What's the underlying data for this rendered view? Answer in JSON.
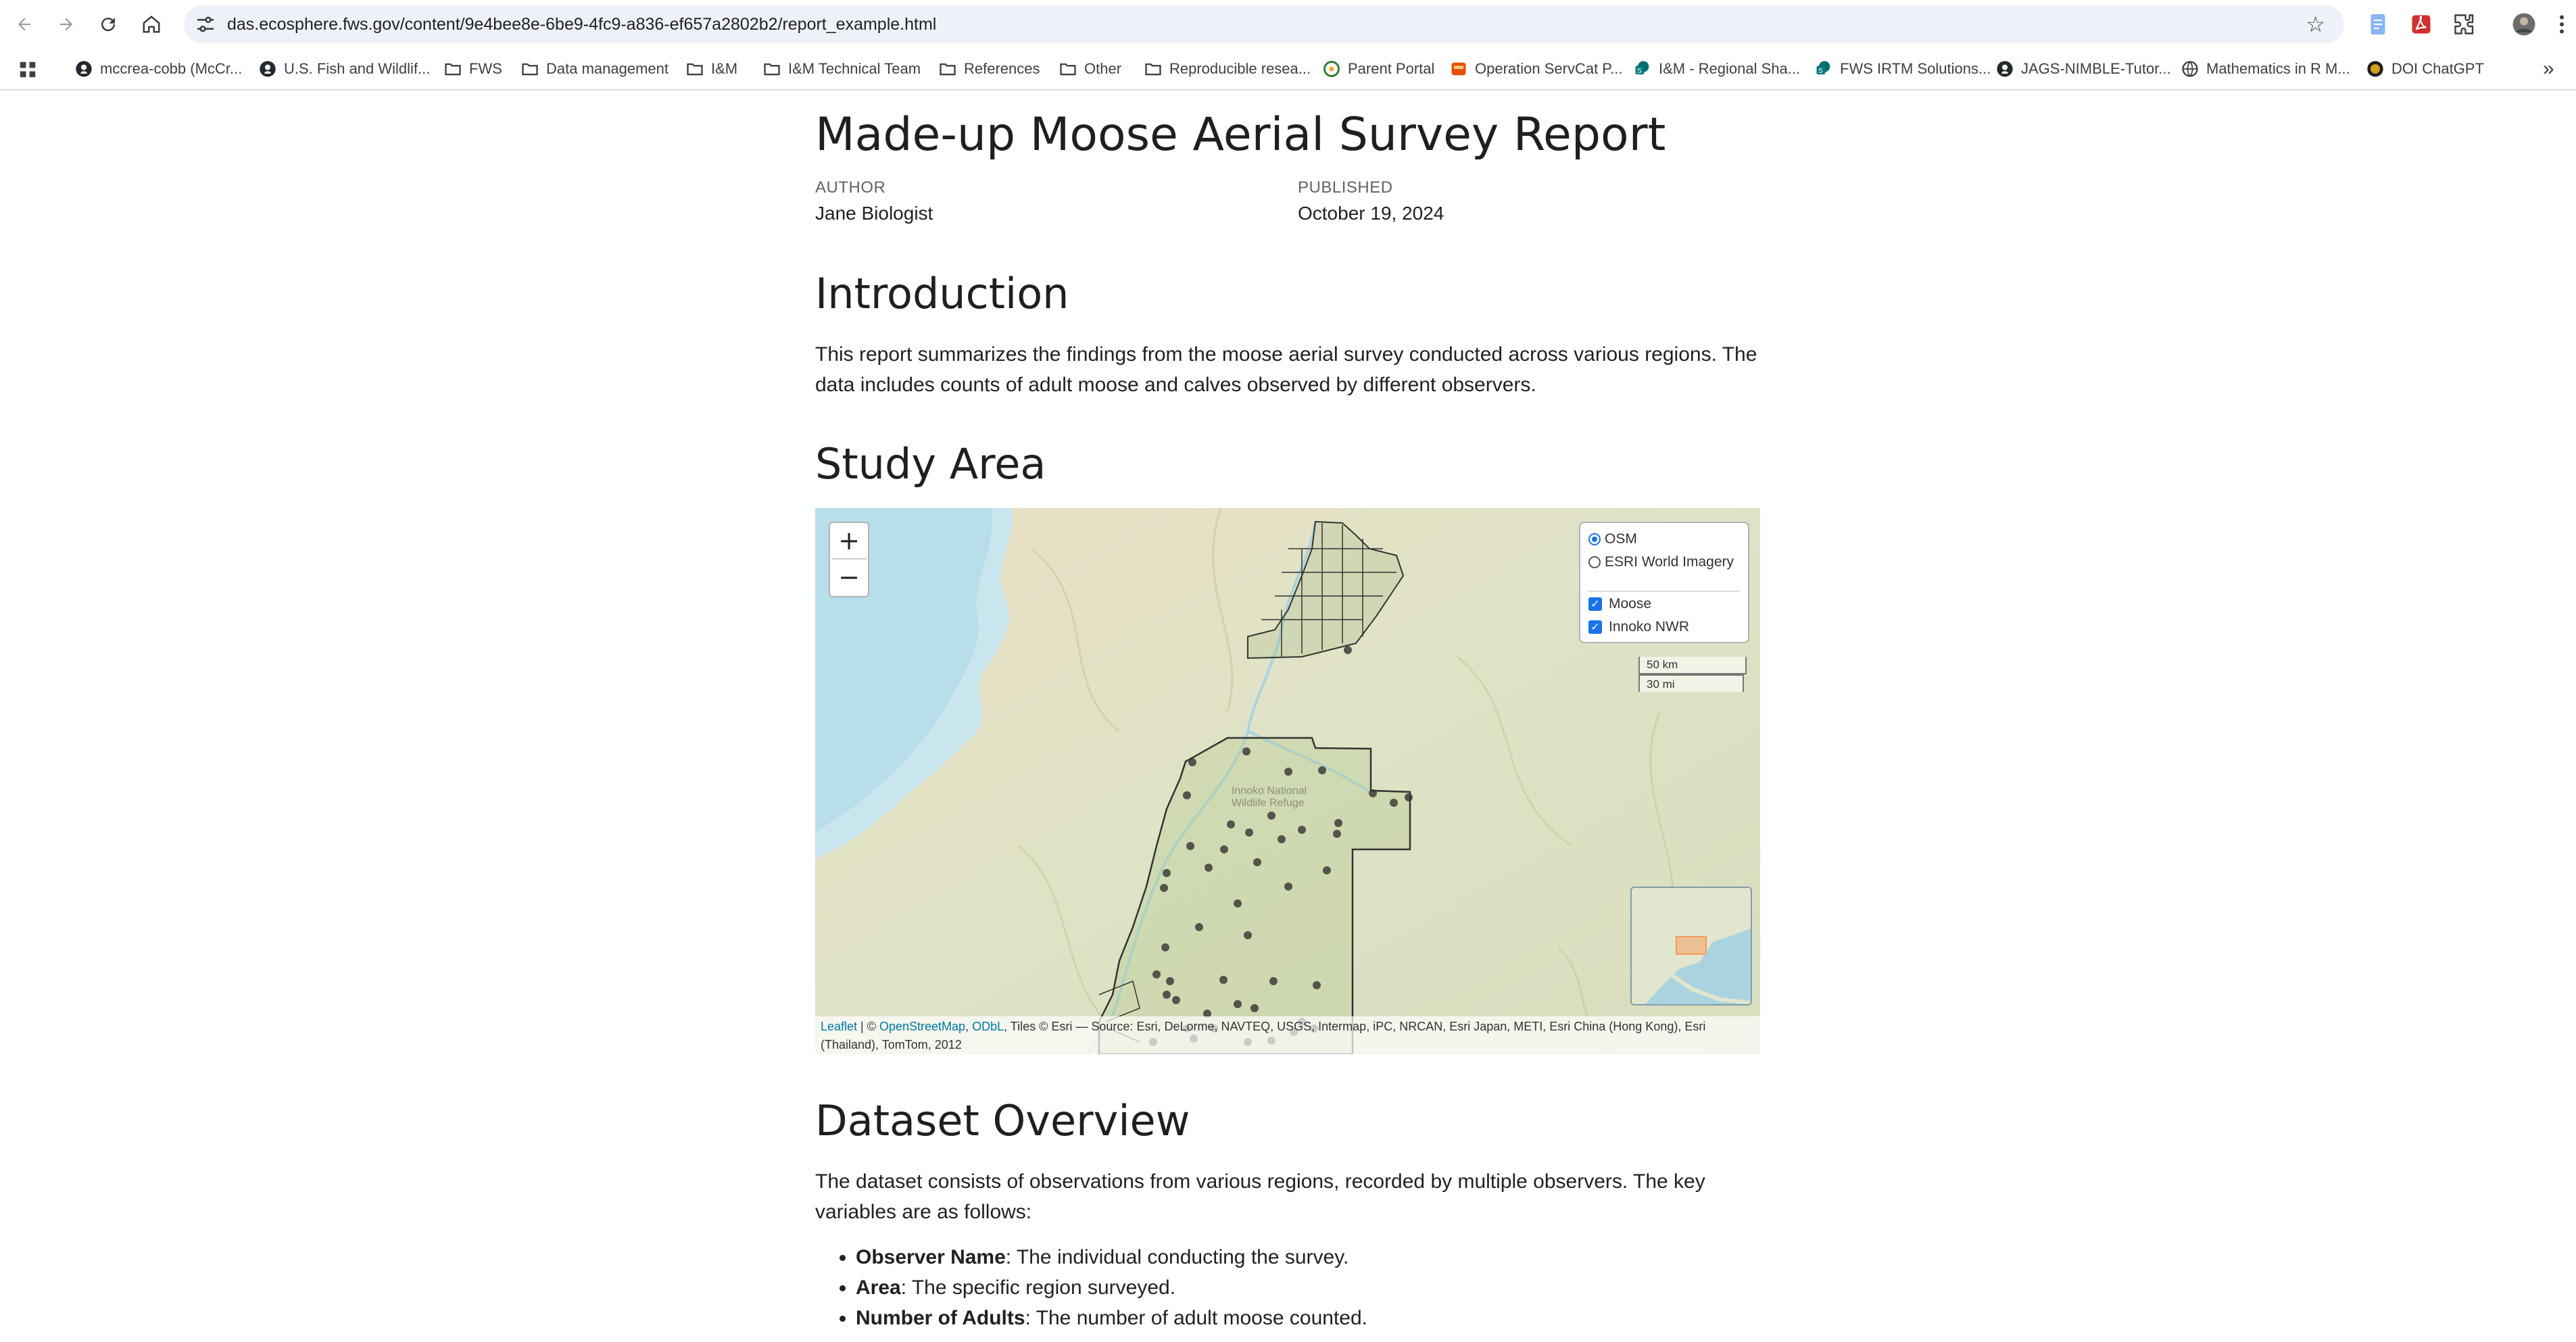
{
  "browser": {
    "url": "das.ecosphere.fws.gov/content/9e4bee8e-6be9-4fc9-a836-ef657a2802b2/report_example.html",
    "nav_icons": [
      "back-arrow-icon",
      "forward-arrow-icon",
      "reload-icon",
      "home-icon"
    ],
    "extension_icons": [
      "docs-icon",
      "acrobat-icon",
      "puzzle-icon",
      "profile-avatar",
      "kebab-menu-icon"
    ],
    "bookmarks": [
      {
        "label": "mccrea-cobb (McCr...",
        "icon": "github-icon"
      },
      {
        "label": "U.S. Fish and Wildlif...",
        "icon": "github-icon"
      },
      {
        "label": "FWS",
        "icon": "folder-icon"
      },
      {
        "label": "Data management",
        "icon": "folder-icon"
      },
      {
        "label": "I&M",
        "icon": "folder-icon"
      },
      {
        "label": "I&M Technical Team",
        "icon": "folder-icon"
      },
      {
        "label": "References",
        "icon": "folder-icon"
      },
      {
        "label": "Other",
        "icon": "folder-icon"
      },
      {
        "label": "Reproducible resea...",
        "icon": "folder-icon"
      },
      {
        "label": "Parent Portal",
        "icon": "portal-icon"
      },
      {
        "label": "Operation ServCat P...",
        "icon": "servcat-icon"
      },
      {
        "label": "I&M - Regional Sha...",
        "icon": "sharepoint-icon"
      },
      {
        "label": "FWS IRTM Solutions...",
        "icon": "sharepoint-icon"
      },
      {
        "label": "JAGS-NIMBLE-Tutor...",
        "icon": "github-icon"
      },
      {
        "label": "Mathematics in R M...",
        "icon": "globe-icon"
      },
      {
        "label": "DOI ChatGPT",
        "icon": "chatgpt-icon"
      }
    ],
    "more_bookmarks": "»"
  },
  "article": {
    "title": "Made-up Moose Aerial Survey Report",
    "author_label": "AUTHOR",
    "author": "Jane Biologist",
    "published_label": "PUBLISHED",
    "published": "October 19, 2024",
    "intro_heading": "Introduction",
    "intro_text": "This report summarizes the findings from the moose aerial survey conducted across various regions. The data includes counts of adult moose and calves observed by different observers.",
    "study_heading": "Study Area",
    "dataset_heading": "Dataset Overview",
    "dataset_text": "The dataset consists of observations from various regions, recorded by multiple observers. The key variables are as follows:",
    "variables": [
      {
        "name": "Observer Name",
        "desc": ": The individual conducting the survey."
      },
      {
        "name": "Area",
        "desc": ": The specific region surveyed."
      },
      {
        "name": "Number of Adults",
        "desc": ": The number of adult moose counted."
      }
    ]
  },
  "map": {
    "zoom_in": "+",
    "zoom_out": "−",
    "base_layers": [
      {
        "label": "OSM",
        "selected": true
      },
      {
        "label": "ESRI World Imagery",
        "selected": false
      }
    ],
    "overlays": [
      {
        "label": "Moose",
        "checked": true
      },
      {
        "label": "Innoko NWR",
        "checked": true
      }
    ],
    "scale_km": "50 km",
    "scale_mi": "30 mi",
    "refuge_label_1": "Innoko National",
    "refuge_label_2": "Wildlife Refuge",
    "attribution_leaflet": "Leaflet",
    "attribution_sep": " | © ",
    "attribution_osm": "OpenStreetMap",
    "attribution_comma": ", ",
    "attribution_odbl": "ODbL",
    "attribution_rest": ", Tiles © Esri — Source: Esri, DeLorme, NAVTEQ, USGS, Intermap, iPC, NRCAN, Esri Japan, METI, Esri China (Hong Kong), Esri (Thailand), TomTom, 2012",
    "colors": {
      "water": "#aad3df",
      "land": "#e2e6cf",
      "boundary": "#333333",
      "point": "#333333",
      "minimap_box": "#f39c5a"
    }
  }
}
